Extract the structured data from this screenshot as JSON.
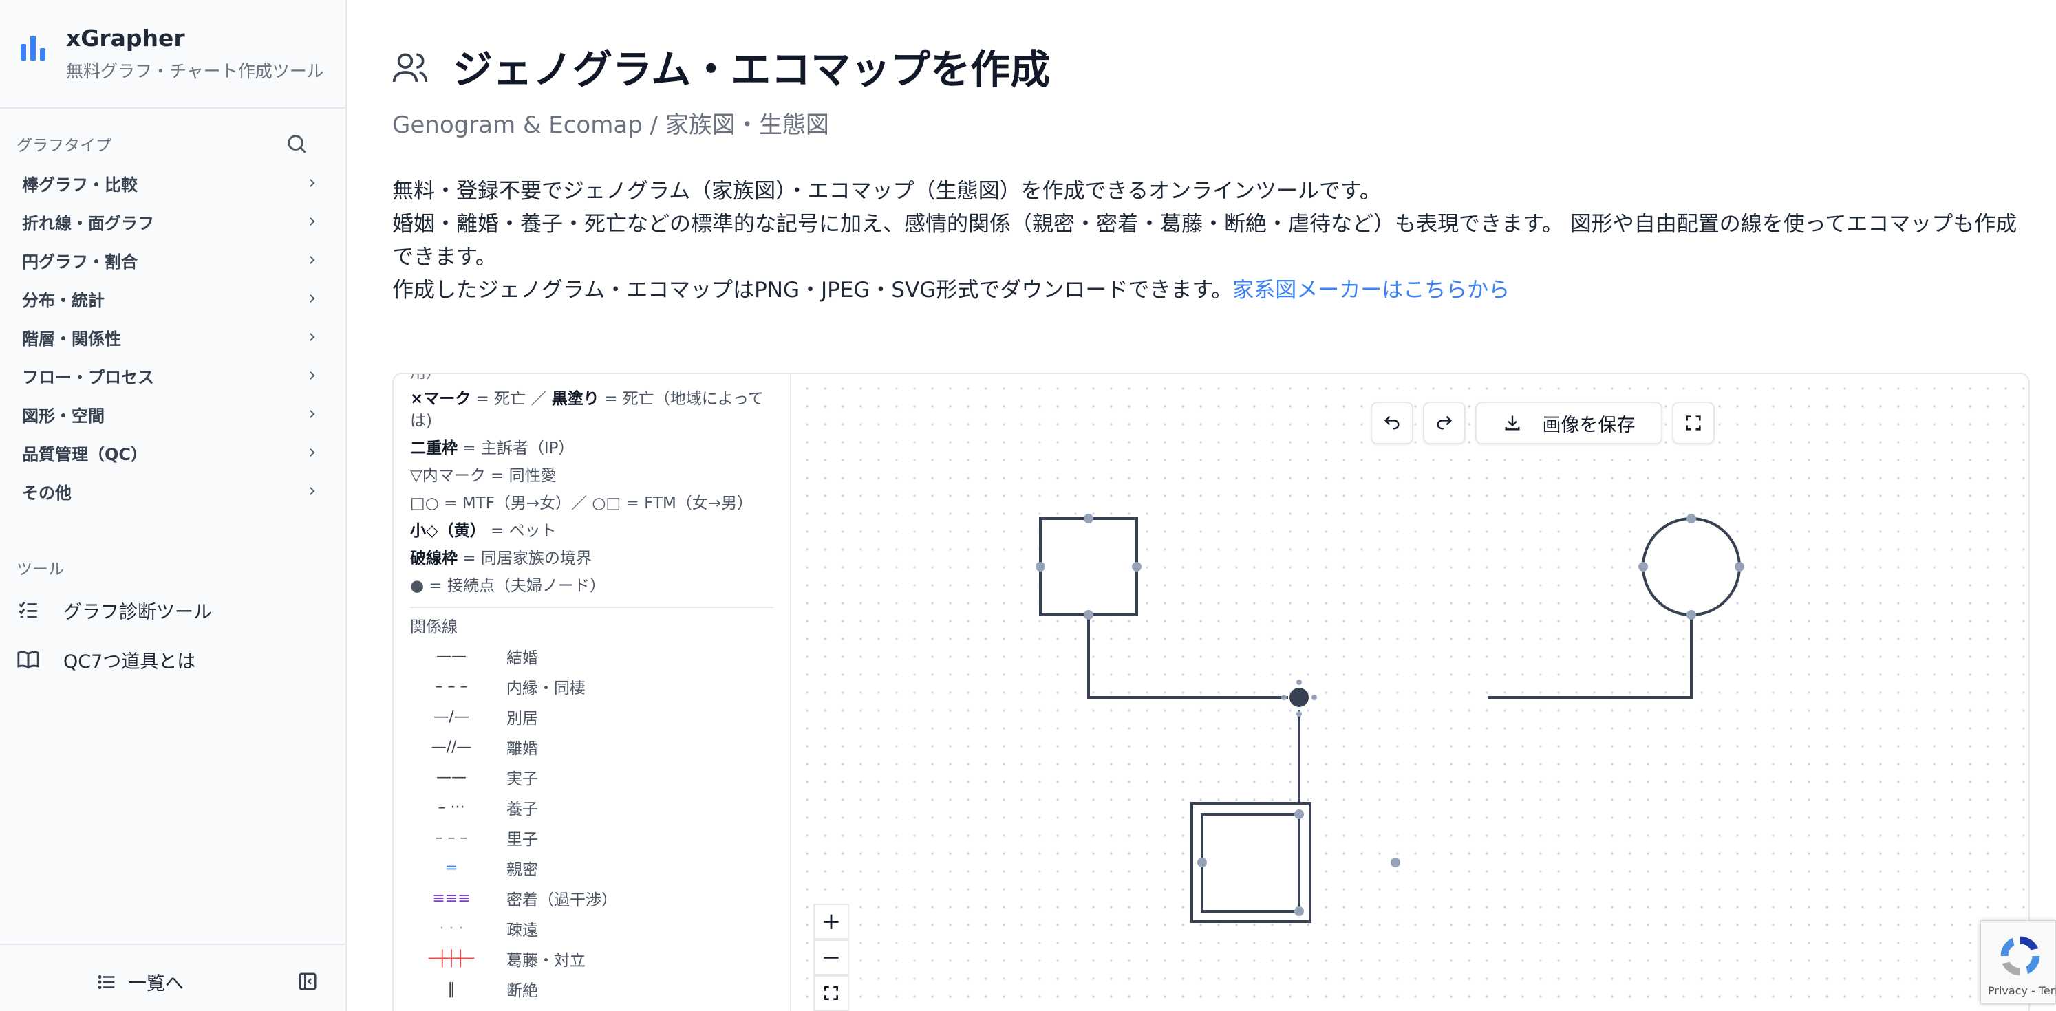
{
  "brand": {
    "name": "xGrapher",
    "tagline": "無料グラフ・チャート作成ツール"
  },
  "sidebar": {
    "graph_types_label": "グラフタイプ",
    "items": [
      {
        "label": "棒グラフ・比較"
      },
      {
        "label": "折れ線・面グラフ"
      },
      {
        "label": "円グラフ・割合"
      },
      {
        "label": "分布・統計"
      },
      {
        "label": "階層・関係性"
      },
      {
        "label": "フロー・プロセス"
      },
      {
        "label": "図形・空間"
      },
      {
        "label": "品質管理（QC）"
      },
      {
        "label": "その他"
      }
    ],
    "tools_label": "ツール",
    "tools": [
      {
        "label": "グラフ診断ツール",
        "icon": "list-check-icon"
      },
      {
        "label": "QC7つ道具とは",
        "icon": "book-icon"
      }
    ],
    "footer_label": "一覧へ"
  },
  "header": {
    "title": "ジェノグラム・エコマップを作成",
    "subtitle": "Genogram & Ecomap / 家族図・生態図",
    "desc_line1": "無料・登録不要でジェノグラム（家族図）・エコマップ（生態図）を作成できるオンラインツールです。",
    "desc_line2": "婚姻・離婚・養子・死亡などの標準的な記号に加え、感情的関係（親密・密着・葛藤・断絶・虐待など）も表現できます。 図形や自由配置の線を使ってエコマップも作成できます。",
    "desc_line3": "作成したジェノグラム・エコマップはPNG・JPEG・SVG形式でダウンロードできます。",
    "link_text": "家系図メーカーはこちらから"
  },
  "legend": {
    "symbols": [
      {
        "bold": "×マーク",
        "text": " = 死亡 ／ ",
        "bold2": "黒塗り",
        "text2": " = 死亡（地域によっては)"
      },
      {
        "bold": "二重枠",
        "text": " = 主訴者（IP）"
      },
      {
        "bold": "",
        "text": "▽内マーク = 同性愛"
      },
      {
        "bold": "",
        "text": "□○ = MTF（男→女）／ ○□ = FTM（女→男）"
      },
      {
        "bold": "小◇（黄）",
        "text": " = ペット"
      },
      {
        "bold": "破線枠",
        "text": " = 同居家族の境界"
      },
      {
        "bold": "",
        "text": "● = 接続点（夫婦ノード）"
      }
    ],
    "relations_label": "関係線",
    "relations": [
      {
        "symbol": "——",
        "label": "結婚"
      },
      {
        "symbol": "– – –",
        "label": "内縁・同棲"
      },
      {
        "symbol": "—/—",
        "label": "別居"
      },
      {
        "symbol": "—//—",
        "label": "離婚"
      },
      {
        "symbol": "——",
        "label": "実子"
      },
      {
        "symbol": "– ···",
        "label": "養子"
      },
      {
        "symbol": "– – –",
        "label": "里子"
      },
      {
        "symbol": "═",
        "label": "親密"
      },
      {
        "symbol": "≡≡≡",
        "label": "密着（過干渉）"
      },
      {
        "symbol": "· · ·",
        "label": "疎遠"
      },
      {
        "symbol": "─┼┼┼─",
        "label": "葛藤・対立"
      },
      {
        "symbol": "‖",
        "label": "断絶"
      }
    ],
    "colors": {
      "close": "#3b82f6",
      "enmeshed": "#7c3aed",
      "conflict": "#ef4444"
    }
  },
  "toolbar": {
    "save_label": "画像を保存",
    "undo": "undo-icon",
    "redo": "redo-icon",
    "fullscreen": "fullscreen-icon"
  },
  "zoom_controls": {
    "in": "+",
    "out": "−"
  },
  "recaptcha": {
    "text": "Privacy - Terms"
  },
  "colors": {
    "accent": "#3b82f6",
    "node_stroke": "#374151",
    "handle": "#94a3b8"
  }
}
